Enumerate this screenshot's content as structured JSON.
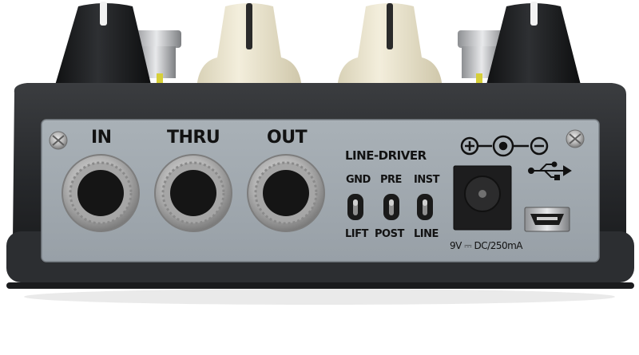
{
  "jacks": {
    "in": "IN",
    "thru": "THRU",
    "out": "OUT"
  },
  "line_driver": {
    "title": "LINE-DRIVER",
    "top_labels": [
      "GND",
      "PRE",
      "INST"
    ],
    "bottom_labels": [
      "LIFT",
      "POST",
      "LINE"
    ]
  },
  "power": {
    "polarity_symbol": "⊕–◐–⊖",
    "rating": "9V ⎓ DC/250mA"
  },
  "icons": [
    "usb-icon",
    "polarity-icon",
    "screw-icon",
    "jack-icon",
    "toggle-switch-icon",
    "dc-socket-icon",
    "mini-usb-port-icon",
    "knob-icon"
  ],
  "colors": {
    "panel": "#a4acb3",
    "body": "#2a2c2f",
    "knob_cream": "#ece6cf",
    "knob_black": "#1b1c1e"
  }
}
